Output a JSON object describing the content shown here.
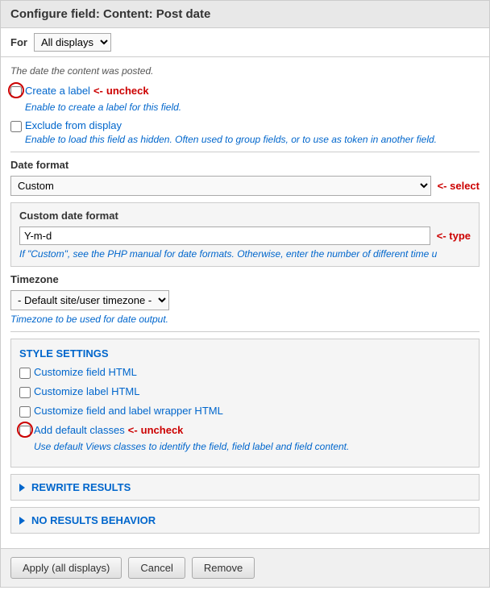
{
  "header": {
    "title": "Configure field: Content: Post date"
  },
  "for_row": {
    "label": "For",
    "select_value": "All displays",
    "select_options": [
      "All displays"
    ]
  },
  "description": "The date the content was posted.",
  "create_label": {
    "checkbox_label": "Create a label",
    "hint": "Enable to create a label for this field.",
    "annotation": "<- uncheck"
  },
  "exclude_display": {
    "checkbox_label": "Exclude from display",
    "hint": "Enable to load this field as hidden. Often used to group fields, or to use as token in another field."
  },
  "date_format": {
    "label": "Date format",
    "select_value": "Custom",
    "select_options": [
      "Custom"
    ],
    "annotation": "<- select"
  },
  "custom_date_format": {
    "label": "Custom date format",
    "value": "Y-m-d",
    "hint": "If \"Custom\", see the PHP manual for date formats. Otherwise, enter the number of different time u",
    "annotation": "<- type"
  },
  "timezone": {
    "label": "Timezone",
    "select_value": "- Default site/user timezone -",
    "select_options": [
      "- Default site/user timezone -"
    ],
    "hint": "Timezone to be used for date output."
  },
  "style_settings": {
    "title": "STYLE SETTINGS",
    "items": [
      {
        "label": "Customize field HTML",
        "checked": false
      },
      {
        "label": "Customize label HTML",
        "checked": false
      },
      {
        "label": "Customize field and label wrapper HTML",
        "checked": false
      }
    ],
    "add_default": {
      "label": "Add default classes",
      "checked": false,
      "annotation": "<- uncheck",
      "hint": "Use default Views classes to identify the field, field label and field content."
    }
  },
  "rewrite_results": {
    "title": "REWRITE RESULTS"
  },
  "no_results": {
    "title": "NO RESULTS BEHAVIOR"
  },
  "footer": {
    "apply_label": "Apply (all displays)",
    "cancel_label": "Cancel",
    "remove_label": "Remove"
  }
}
